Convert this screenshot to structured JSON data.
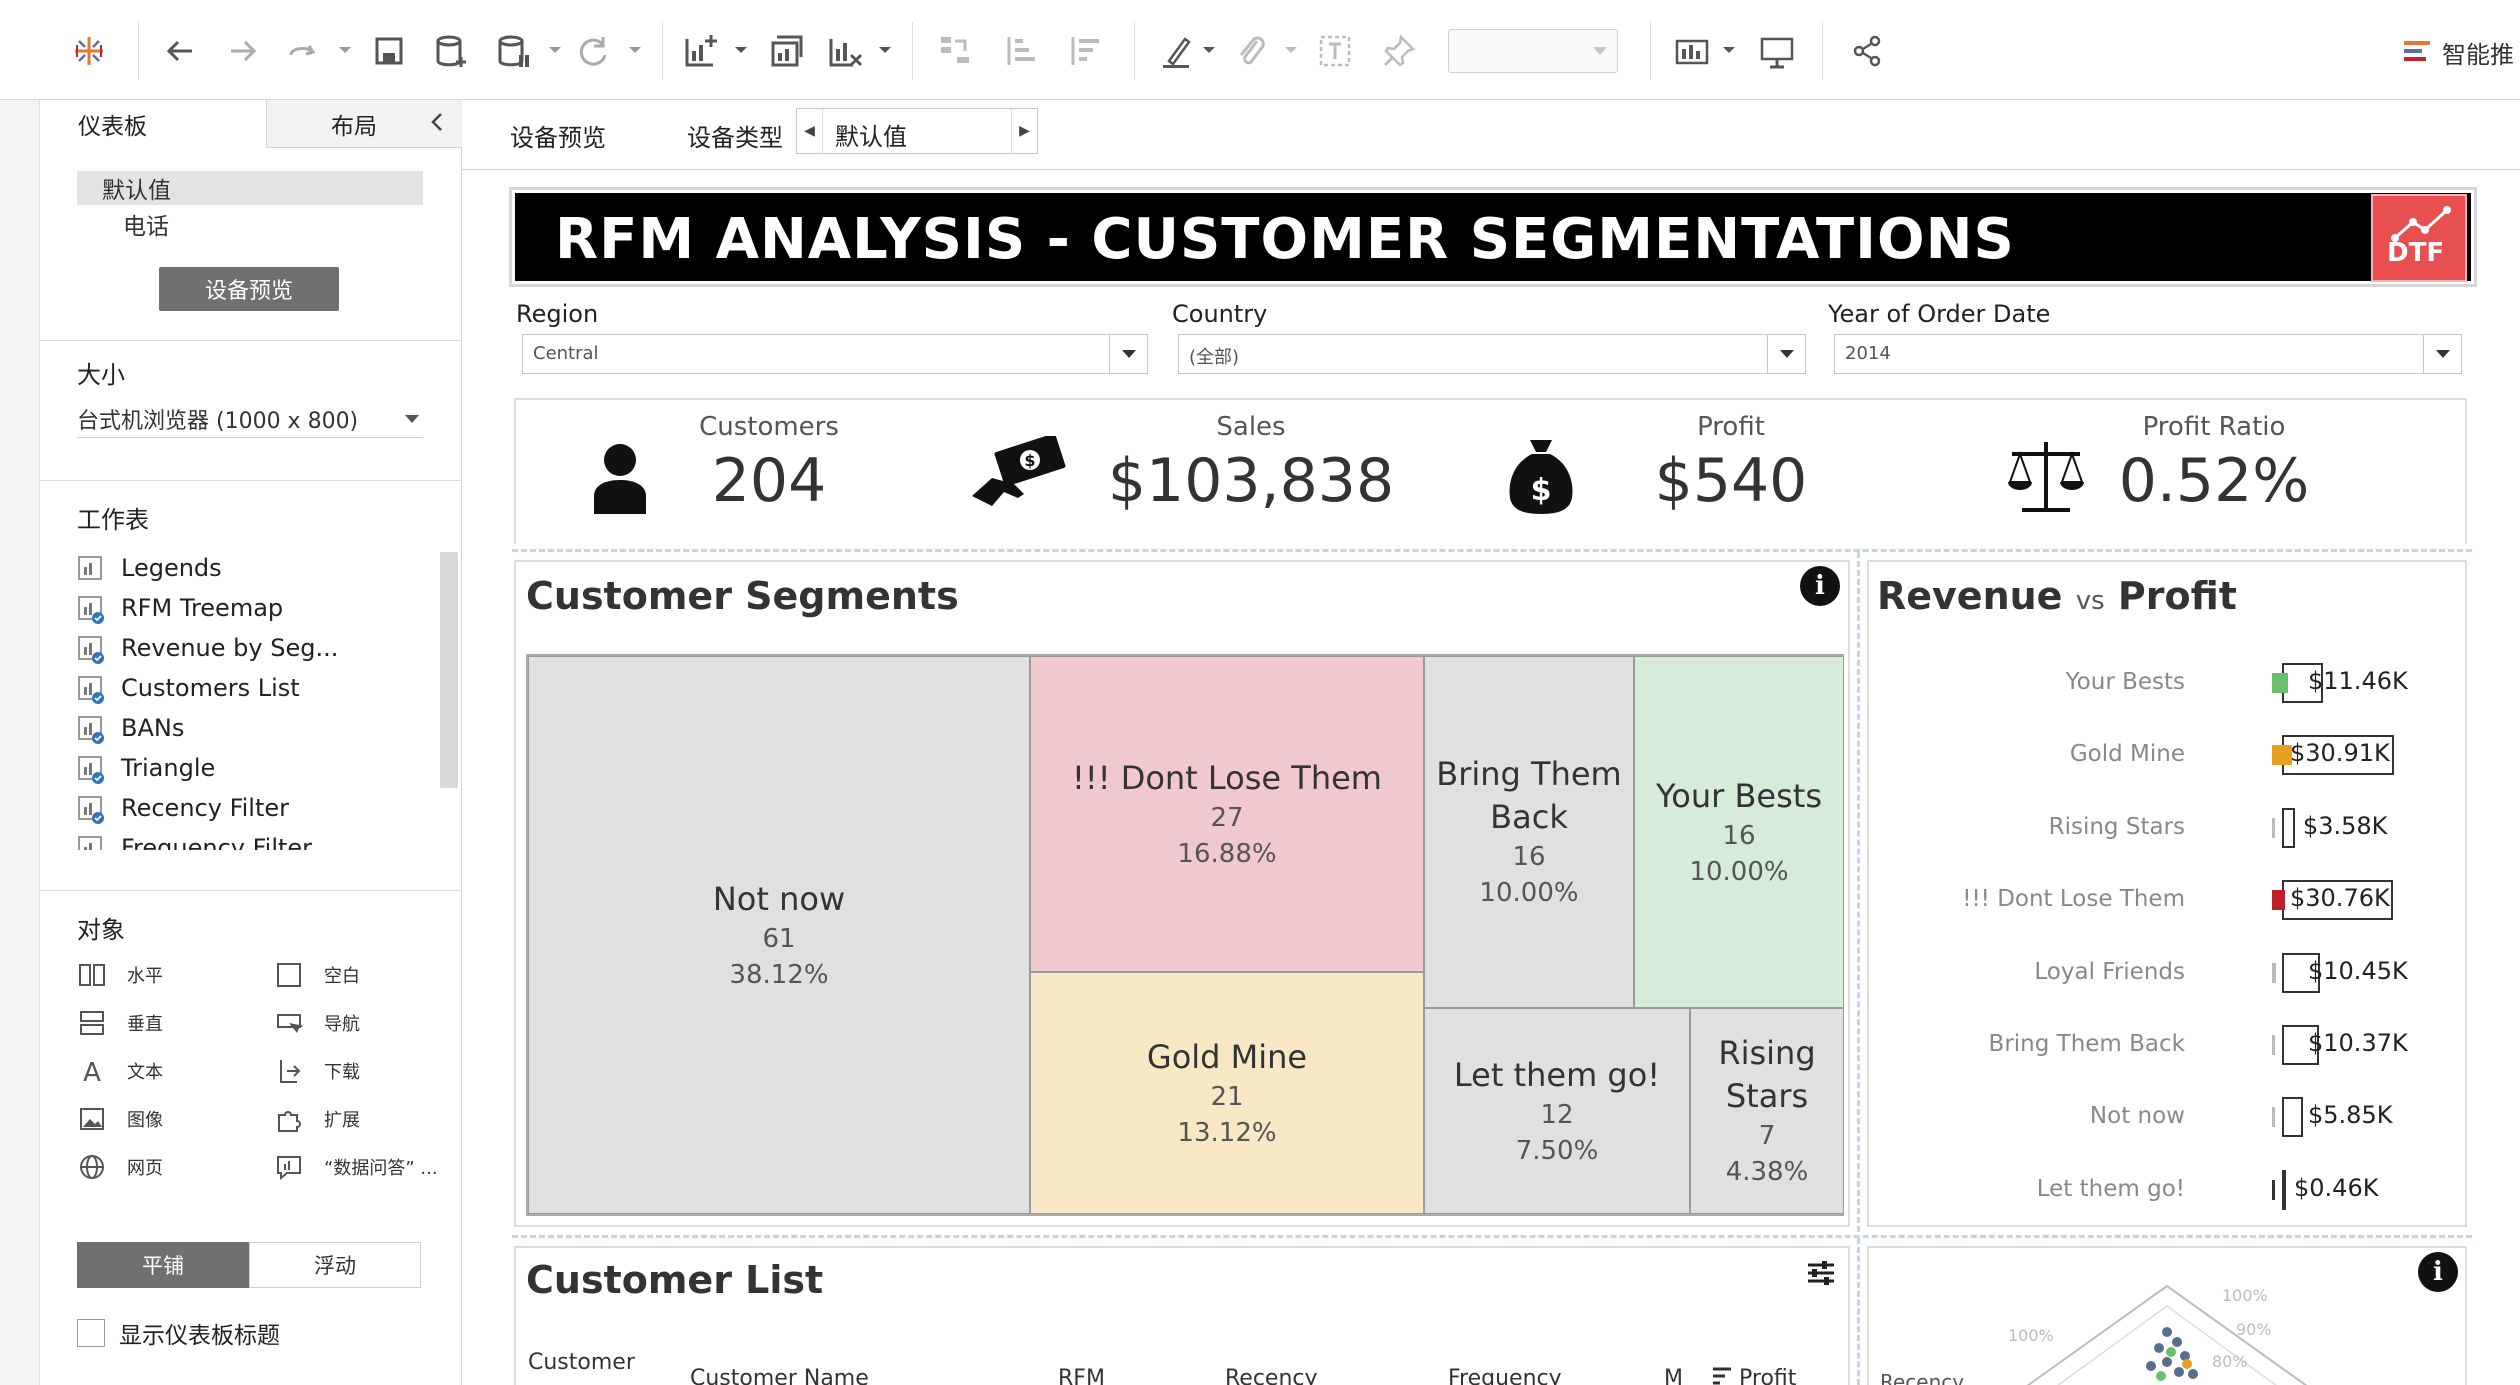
{
  "toolbar": {
    "smart_label": "智能推"
  },
  "left_panel": {
    "tabs": [
      "仪表板",
      "布局"
    ],
    "devices": [
      "默认值",
      "电话"
    ],
    "device_preview_button": "设备预览",
    "size": {
      "title": "大小",
      "value": "台式机浏览器 (1000 x 800)"
    },
    "sheets_title": "工作表",
    "sheets": [
      "Legends",
      "RFM Treemap",
      "Revenue by Seg...",
      "Customers List",
      "BANs",
      "Triangle",
      "Recency Filter",
      "Frequency Filter"
    ],
    "objects_title": "对象",
    "objects": [
      {
        "label": "水平",
        "icon": "horizontal-icon"
      },
      {
        "label": "空白",
        "icon": "blank-icon"
      },
      {
        "label": "垂直",
        "icon": "vertical-icon"
      },
      {
        "label": "导航",
        "icon": "navigation-icon"
      },
      {
        "label": "文本",
        "icon": "text-icon"
      },
      {
        "label": "下载",
        "icon": "download-icon"
      },
      {
        "label": "图像",
        "icon": "image-icon"
      },
      {
        "label": "扩展",
        "icon": "extension-icon"
      },
      {
        "label": "网页",
        "icon": "web-page-icon"
      },
      {
        "label": "“数据问答” ...",
        "icon": "ask-data-icon"
      }
    ],
    "layout_buttons": [
      "平铺",
      "浮动"
    ],
    "show_title_label": "显示仪表板标题"
  },
  "device_bar": {
    "preview_label": "设备预览",
    "type_label": "设备类型",
    "type_value": "默认值"
  },
  "dashboard": {
    "title": "RFM ANALYSIS - CUSTOMER SEGMENTATIONS",
    "logo_text": "DTF",
    "filters": [
      {
        "label": "Region",
        "value": "Central"
      },
      {
        "label": "Country",
        "value": "(全部)"
      },
      {
        "label": "Year of Order Date",
        "value": "2014"
      }
    ],
    "bans": [
      {
        "label": "Customers",
        "value": "204",
        "icon": "person-icon"
      },
      {
        "label": "Sales",
        "value": "$103,838",
        "icon": "money-hand-icon"
      },
      {
        "label": "Profit",
        "value": "$540",
        "icon": "money-bag-icon"
      },
      {
        "label": "Profit Ratio",
        "value": "0.52%",
        "icon": "scales-icon"
      }
    ],
    "segments_title": "Customer Segments",
    "segments": [
      {
        "name": "Not now",
        "count": "61",
        "pct": "38.12%",
        "color": "#e0e0e0"
      },
      {
        "name": "!!! Dont Lose Them",
        "count": "27",
        "pct": "16.88%",
        "color": "#f0c9ce"
      },
      {
        "name": "Gold Mine",
        "count": "21",
        "pct": "13.12%",
        "color": "#f8e8c6"
      },
      {
        "name": "Bring Them Back",
        "count": "16",
        "pct": "10.00%",
        "color": "#e0e0e0"
      },
      {
        "name": "Your Bests",
        "count": "16",
        "pct": "10.00%",
        "color": "#d4ecd8"
      },
      {
        "name": "Let them go!",
        "count": "12",
        "pct": "7.50%",
        "color": "#e0e0e0"
      },
      {
        "name": "Rising Stars",
        "count": "7",
        "pct": "4.38%",
        "color": "#e0e0e0"
      }
    ],
    "revenue_title_a": "Revenue",
    "revenue_title_vs": "vs",
    "revenue_title_b": "Profit",
    "customer_list_title": "Customer List",
    "customer_list_columns": [
      "Customer",
      "Customer Name",
      "RFM",
      "Recency",
      "Frequency",
      "M",
      "Profit"
    ],
    "triangle": {
      "axis_label": "Recency",
      "tick_labels": [
        "100%",
        "90%",
        "80%",
        "100%",
        "90%",
        "80%"
      ]
    }
  },
  "chart_data": {
    "type": "bar",
    "title": "Revenue vs Profit",
    "categories": [
      "Your Bests",
      "Gold Mine",
      "Rising Stars",
      "!!! Dont Lose Them",
      "Loyal Friends",
      "Bring Them Back",
      "Not now",
      "Let them go!"
    ],
    "series": [
      {
        "name": "Revenue",
        "values": [
          11460,
          30910,
          3580,
          30760,
          10450,
          10370,
          5850,
          460
        ]
      },
      {
        "name": "Profit",
        "values": [
          1500,
          1800,
          150,
          1200,
          350,
          300,
          200,
          60
        ]
      }
    ],
    "value_labels": [
      "$11.46K",
      "$30.91K",
      "$3.58K",
      "$30.76K",
      "$10.45K",
      "$10.37K",
      "$5.85K",
      "$0.46K"
    ],
    "profit_colors": [
      "#6cbf6a",
      "#e8a020",
      "#bbbbbb",
      "#c0202a",
      "#bbbbbb",
      "#bbbbbb",
      "#bbbbbb",
      "#333333"
    ],
    "xlim": [
      0,
      31000
    ]
  }
}
